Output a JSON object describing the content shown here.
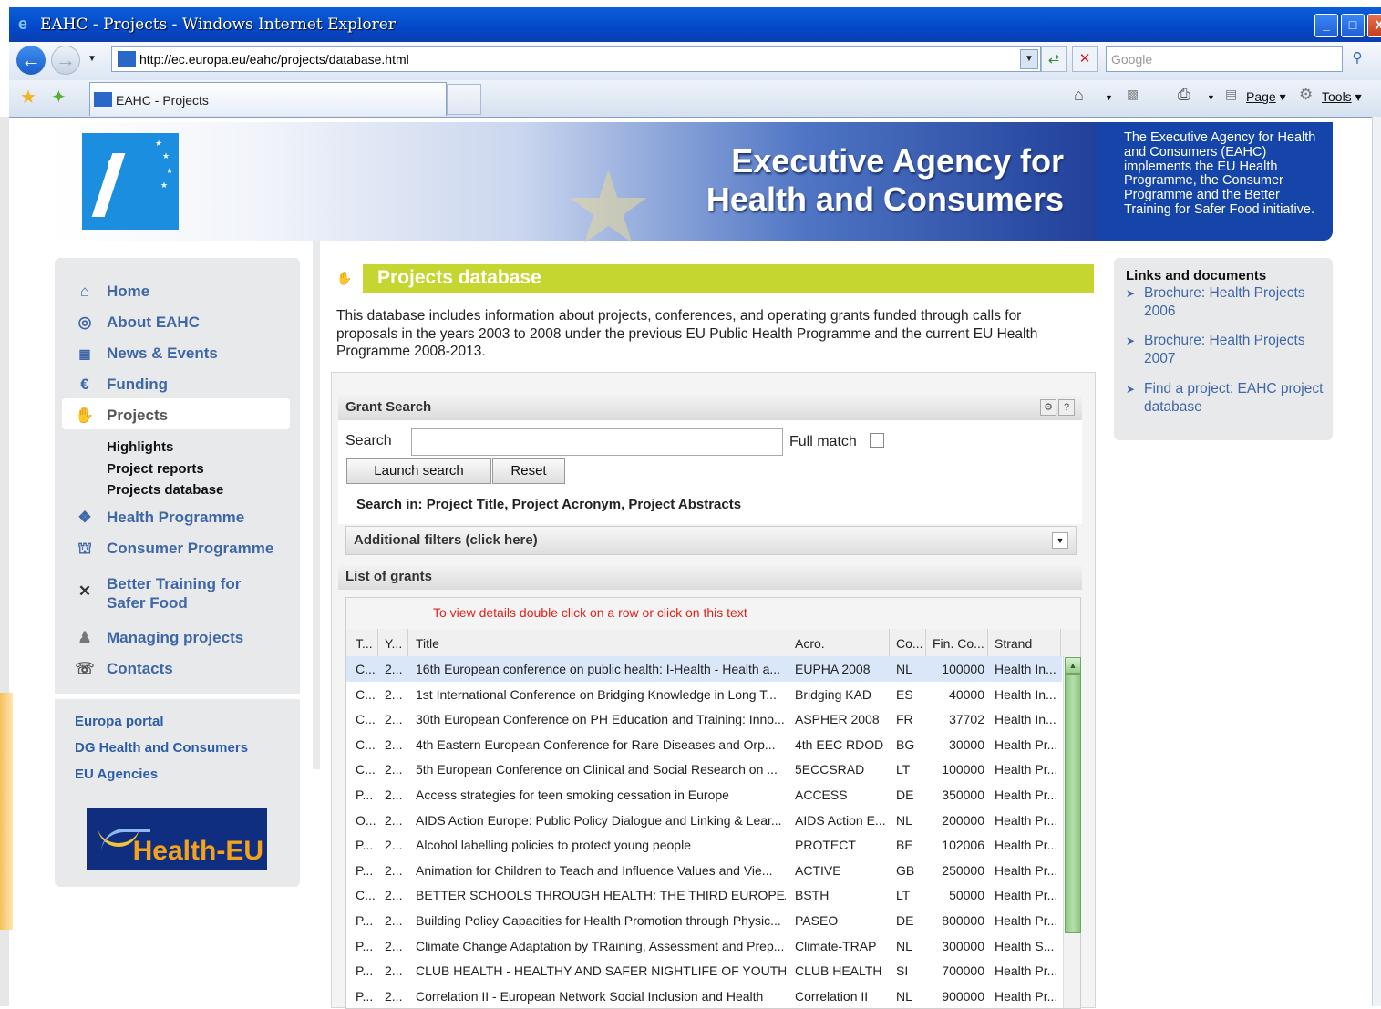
{
  "window": {
    "title": "EAHC - Projects - Windows Internet Explorer",
    "controls": [
      "_",
      "□",
      "X"
    ]
  },
  "browser": {
    "url": "http://ec.europa.eu/eahc/projects/database.html",
    "search_placeholder": "Google",
    "tab_title": "EAHC - Projects",
    "commands": {
      "page": "Page",
      "tools": "Tools"
    }
  },
  "banner": {
    "title_line1": "Executive Agency for",
    "title_line2": "Health and Consumers",
    "description": "The Executive Agency for Health and Consumers (EAHC) implements the EU Health Programme, the Consumer Programme and the Better Training for Safer Food initiative."
  },
  "sidebar": {
    "items": [
      {
        "label": "Home",
        "icon": "home-icon"
      },
      {
        "label": "About EAHC",
        "icon": "info-icon"
      },
      {
        "label": "News & Events",
        "icon": "calendar-icon"
      },
      {
        "label": "Funding",
        "icon": "euro-icon"
      },
      {
        "label": "Projects",
        "icon": "handshake-icon"
      },
      {
        "label": "Health Programme",
        "icon": "health-icon"
      },
      {
        "label": "Consumer Programme",
        "icon": "basket-icon"
      },
      {
        "label": "Better Training for Safer Food",
        "icon": "fork-knife-icon"
      },
      {
        "label": "Managing projects",
        "icon": "people-icon"
      },
      {
        "label": "Contacts",
        "icon": "phone-icon"
      }
    ],
    "subitems": [
      "Highlights",
      "Project reports",
      "Projects database"
    ],
    "links": [
      "Europa portal",
      "DG Health and Consumers",
      "EU Agencies"
    ],
    "logo_text": "Health-EU"
  },
  "main": {
    "heading": "Projects database",
    "intro": "This database includes information about projects, conferences, and operating grants funded through calls for proposals in the years 2003 to 2008 under the previous EU Public Health Programme and the current EU Health Programme 2008-2013.",
    "grant_search": {
      "title": "Grant Search",
      "search_label": "Search",
      "search_value": "",
      "full_match_label": "Full match",
      "full_match_checked": false,
      "launch_button": "Launch search",
      "reset_button": "Reset",
      "search_in": "Search in: Project Title, Project Acronym, Project Abstracts",
      "additional_filters": "Additional filters (click here)"
    },
    "grants": {
      "title": "List of grants",
      "hint": "To view details double click on a row or click on this text",
      "columns": [
        "T...",
        "Y...",
        "Title",
        "Acro.",
        "Co...",
        "Fin. Co...",
        "Strand"
      ],
      "rows": [
        [
          "C...",
          "2...",
          "16th European conference on public health: I-Health - Health a...",
          "EUPHA 2008",
          "NL",
          "100000",
          "Health In..."
        ],
        [
          "C...",
          "2...",
          "1st International Conference on Bridging Knowledge in Long T...",
          "Bridging KAD",
          "ES",
          "40000",
          "Health In..."
        ],
        [
          "C...",
          "2...",
          "30th European Conference on PH Education and Training: Inno...",
          "ASPHER 2008",
          "FR",
          "37702",
          "Health In..."
        ],
        [
          "C...",
          "2...",
          "4th Eastern European Conference for Rare Diseases and Orp...",
          "4th EEC RDOD",
          "BG",
          "30000",
          "Health Pr..."
        ],
        [
          "C...",
          "2...",
          "5th European Conference on Clinical and Social Research on ...",
          "5ECCSRAD",
          "LT",
          "100000",
          "Health Pr..."
        ],
        [
          "P...",
          "2...",
          "Access strategies for teen smoking cessation in Europe",
          "ACCESS",
          "DE",
          "350000",
          "Health Pr..."
        ],
        [
          "O...",
          "2...",
          "AIDS Action Europe: Public Policy Dialogue and Linking & Lear...",
          "AIDS Action E...",
          "NL",
          "200000",
          "Health Pr..."
        ],
        [
          "P...",
          "2...",
          "Alcohol labelling policies to protect young people",
          "PROTECT",
          "BE",
          "102006",
          "Health Pr..."
        ],
        [
          "P...",
          "2...",
          "Animation for Children to Teach and Influence Values and Vie...",
          "ACTIVE",
          "GB",
          "250000",
          "Health Pr..."
        ],
        [
          "C...",
          "2...",
          "BETTER SCHOOLS THROUGH HEALTH: THE THIRD EUROPEA...",
          "BSTH",
          "LT",
          "50000",
          "Health Pr..."
        ],
        [
          "P...",
          "2...",
          "Building Policy Capacities for Health Promotion through Physic...",
          "PASEO",
          "DE",
          "800000",
          "Health Pr..."
        ],
        [
          "P...",
          "2...",
          "Climate Change Adaptation by TRaining, Assessment and Prep...",
          "Climate-TRAP",
          "NL",
          "300000",
          "Health S..."
        ],
        [
          "P...",
          "2...",
          "CLUB HEALTH - HEALTHY AND SAFER NIGHTLIFE OF YOUTH",
          "CLUB HEALTH",
          "SI",
          "700000",
          "Health Pr..."
        ],
        [
          "P...",
          "2...",
          "Correlation II - European Network Social Inclusion and Health",
          "Correlation II",
          "NL",
          "900000",
          "Health Pr..."
        ]
      ]
    }
  },
  "right_sidebar": {
    "title": "Links and documents",
    "links": [
      "Brochure: Health Projects 2006",
      "Brochure: Health Projects 2007",
      "Find a project: EAHC project database"
    ]
  }
}
